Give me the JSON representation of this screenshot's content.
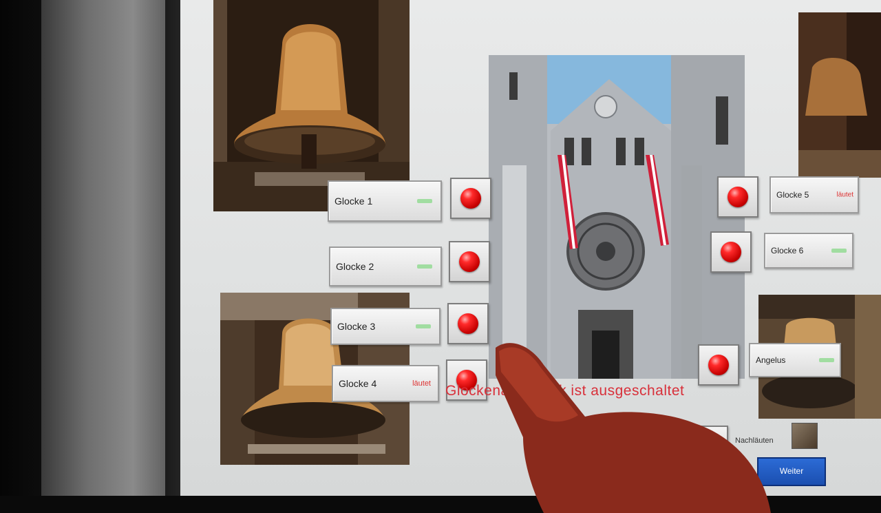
{
  "bells": [
    {
      "label": "Glocke 1",
      "status": ""
    },
    {
      "label": "Glocke 2",
      "status": ""
    },
    {
      "label": "Glocke 3",
      "status": ""
    },
    {
      "label": "Glocke 4",
      "status": "läutet"
    },
    {
      "label": "Glocke 5",
      "status": "läutet"
    },
    {
      "label": "Glocke 6",
      "status": ""
    }
  ],
  "angelus": {
    "label": "Angelus"
  },
  "status_message": "Glockenautomatik ist ausgeschaltet",
  "nachlaeuten_label": "Nachläuten",
  "weiter_label": "Weiter",
  "colors": {
    "status_red": "#d8303a",
    "button_red": "#e01010",
    "weiter_blue": "#1f56c0"
  }
}
